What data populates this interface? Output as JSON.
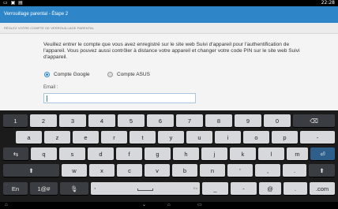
{
  "status_bar": {
    "left_icons": [
      "notification-icon",
      "image-icon",
      "screen-icon"
    ],
    "right_text": "22:28"
  },
  "action_bar": {
    "title": "Verrouillage parental - Étape 2"
  },
  "section_header": "Réglez votre compte de verrouillage parental",
  "intro_text": "Veuillez entrer le compte que vous avez enregistré sur le site web Suivi d'appareil pour l'authentification de l'appareil. Vous pouvez aussi contrôler à distance votre appareil et changer votre code PIN sur le site web Suivi d'appareil.",
  "account_options": {
    "google_label": "Compte Google",
    "asus_label": "Compte ASUS",
    "selected": "google"
  },
  "email": {
    "label": "Email :",
    "value": ""
  },
  "keyboard": {
    "row_numbers": [
      "1",
      "2",
      "3",
      "4",
      "5",
      "6",
      "7",
      "8",
      "9",
      "0"
    ],
    "row1": [
      "a",
      "z",
      "e",
      "r",
      "t",
      "y",
      "u",
      "i",
      "o",
      "p",
      "-"
    ],
    "row2": [
      "q",
      "s",
      "d",
      "f",
      "g",
      "h",
      "j",
      "k",
      "l",
      "m"
    ],
    "row3": [
      "w",
      "x",
      "c",
      "v",
      "b",
      "n",
      "'",
      ",",
      "."
    ],
    "bottom": {
      "lang": "En",
      "symbols": "1@#",
      "space_lang": "En",
      "underscore": "_",
      "dash": "-",
      "at": "@",
      "dot": ".",
      "com": ".com"
    }
  },
  "accent_color": "#2e86c8"
}
